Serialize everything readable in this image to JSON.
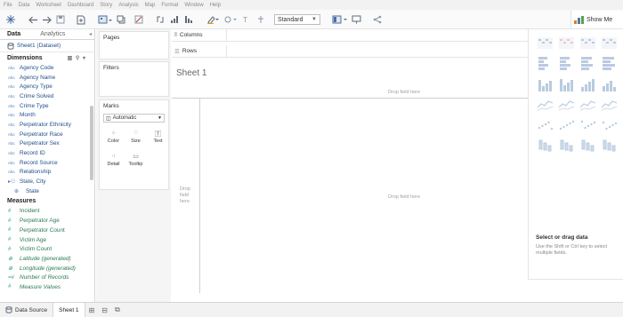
{
  "menu": [
    "File",
    "Data",
    "Worksheet",
    "Dashboard",
    "Story",
    "Analysis",
    "Map",
    "Format",
    "Window",
    "Help"
  ],
  "toolbar": {
    "fit_select": "Standard",
    "show_me_label": "Show Me"
  },
  "data_pane": {
    "tab_data": "Data",
    "tab_analytics": "Analytics",
    "data_source": "Sheet1 (Dataset)",
    "dimensions_header": "Dimensions",
    "dimensions": [
      {
        "type": "Abc",
        "name": "Agency Code"
      },
      {
        "type": "Abc",
        "name": "Agency Name"
      },
      {
        "type": "Abc",
        "name": "Agency Type"
      },
      {
        "type": "Abc",
        "name": "Crime Solved"
      },
      {
        "type": "Abc",
        "name": "Crime Type"
      },
      {
        "type": "Abc",
        "name": "Month"
      },
      {
        "type": "Abc",
        "name": "Perpetrator Ethnicity"
      },
      {
        "type": "Abc",
        "name": "Perpetrator Race"
      },
      {
        "type": "Abc",
        "name": "Perpetrator Sex"
      },
      {
        "type": "Abc",
        "name": "Record ID"
      },
      {
        "type": "Abc",
        "name": "Record Source"
      },
      {
        "type": "Abc",
        "name": "Relationship"
      },
      {
        "type": "",
        "name": "State, City"
      },
      {
        "type": "",
        "name": "State"
      }
    ],
    "measures_header": "Measures",
    "measures": [
      {
        "type": "#",
        "name": "Incident",
        "italic": false
      },
      {
        "type": "#",
        "name": "Perpetrator Age",
        "italic": false
      },
      {
        "type": "#",
        "name": "Perpetrator Count",
        "italic": false
      },
      {
        "type": "#",
        "name": "Victim Age",
        "italic": false
      },
      {
        "type": "#",
        "name": "Victim Count",
        "italic": false
      },
      {
        "type": "⊕",
        "name": "Latitude (generated)",
        "italic": true
      },
      {
        "type": "⊕",
        "name": "Longitude (generated)",
        "italic": true
      },
      {
        "type": "=#",
        "name": "Number of Records",
        "italic": true
      },
      {
        "type": "#",
        "name": "Measure Values",
        "italic": true
      }
    ]
  },
  "shelves": {
    "pages": "Pages",
    "filters": "Filters",
    "marks": "Marks",
    "mark_type": "Automatic",
    "mark_buttons": [
      "Color",
      "Size",
      "Text",
      "Detail",
      "Tooltip"
    ]
  },
  "canvas": {
    "columns": "Columns",
    "rows": "Rows",
    "sheet_title": "Sheet 1",
    "drop_field_top": "Drop field here",
    "drop_field_center": "Drop field here",
    "drop_field_left": "Drop field here"
  },
  "show_me": {
    "title": "Select or drag data",
    "hint": "Use the Shift or Ctrl key to select multiple fields."
  },
  "bottom": {
    "data_source": "Data Source",
    "sheet_tab": "Sheet 1"
  }
}
